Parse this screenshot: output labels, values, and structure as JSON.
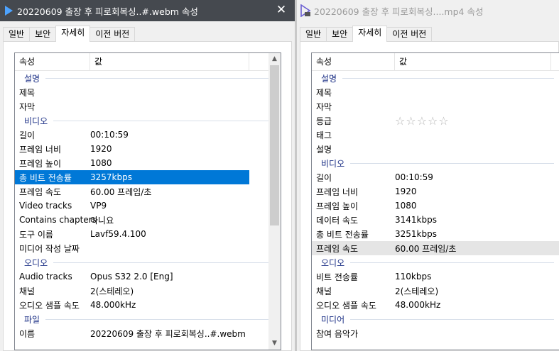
{
  "left": {
    "title": "20220609 출장 후 피로회복싱..#.webm 속성",
    "tabs": [
      "일반",
      "보안",
      "자세히",
      "이전 버전"
    ],
    "header": {
      "property": "속성",
      "value": "값"
    },
    "groups": {
      "description": "설명",
      "video": "비디오",
      "audio": "오디오",
      "file": "파일"
    },
    "desc_rows": [
      {
        "k": "제목",
        "v": ""
      },
      {
        "k": "자막",
        "v": ""
      }
    ],
    "video_rows": [
      {
        "k": "길이",
        "v": "00:10:59"
      },
      {
        "k": "프레임 너비",
        "v": "1920"
      },
      {
        "k": "프레임 높이",
        "v": "1080"
      },
      {
        "k": "총 비트 전송률",
        "v": "3257kbps"
      },
      {
        "k": "프레임 속도",
        "v": "60.00 프레임/초"
      },
      {
        "k": "Video tracks",
        "v": "VP9"
      },
      {
        "k": "Contains chapters",
        "v": "아니요"
      },
      {
        "k": "도구 이름",
        "v": "Lavf59.4.100"
      },
      {
        "k": "미디어 작성 날짜",
        "v": ""
      }
    ],
    "audio_rows": [
      {
        "k": "Audio tracks",
        "v": "Opus S32 2.0 [Eng]"
      },
      {
        "k": "채널",
        "v": "2(스테레오)"
      },
      {
        "k": "오디오 샘플 속도",
        "v": "48.000kHz"
      }
    ],
    "file_rows": [
      {
        "k": "이름",
        "v": "20220609 출장 후 피로회복싱..#.webm"
      }
    ],
    "close_label": "✕"
  },
  "right": {
    "title": "20220609 출장 후 피로회복싱....mp4 속성",
    "tabs": [
      "일반",
      "보안",
      "자세히",
      "이전 버전"
    ],
    "header": {
      "property": "속성",
      "value": "값"
    },
    "groups": {
      "description": "설명",
      "video": "비디오",
      "audio": "오디오",
      "media": "미디어"
    },
    "desc_rows": [
      {
        "k": "제목",
        "v": ""
      },
      {
        "k": "자막",
        "v": ""
      },
      {
        "k": "등급",
        "v": "☆☆☆☆☆"
      },
      {
        "k": "태그",
        "v": ""
      },
      {
        "k": "설명",
        "v": ""
      }
    ],
    "video_rows": [
      {
        "k": "길이",
        "v": "00:10:59"
      },
      {
        "k": "프레임 너비",
        "v": "1920"
      },
      {
        "k": "프레임 높이",
        "v": "1080"
      },
      {
        "k": "데이터 속도",
        "v": "3141kbps"
      },
      {
        "k": "총 비트 전송률",
        "v": "3251kbps"
      },
      {
        "k": "프레임 속도",
        "v": "60.00 프레임/초"
      }
    ],
    "audio_rows": [
      {
        "k": "비트 전송률",
        "v": "110kbps"
      },
      {
        "k": "채널",
        "v": "2(스테레오)"
      },
      {
        "k": "오디오 샘플 속도",
        "v": "48.000kHz"
      }
    ],
    "media_rows": [
      {
        "k": "참여 음악가",
        "v": ""
      }
    ]
  },
  "colors": {
    "selection": "#0078d7",
    "group_text": "#1e3287",
    "left_titlebar": "#45494f"
  },
  "icons": {
    "left_title_icon": "play-file-icon",
    "right_title_icon": "video-file-icon"
  }
}
